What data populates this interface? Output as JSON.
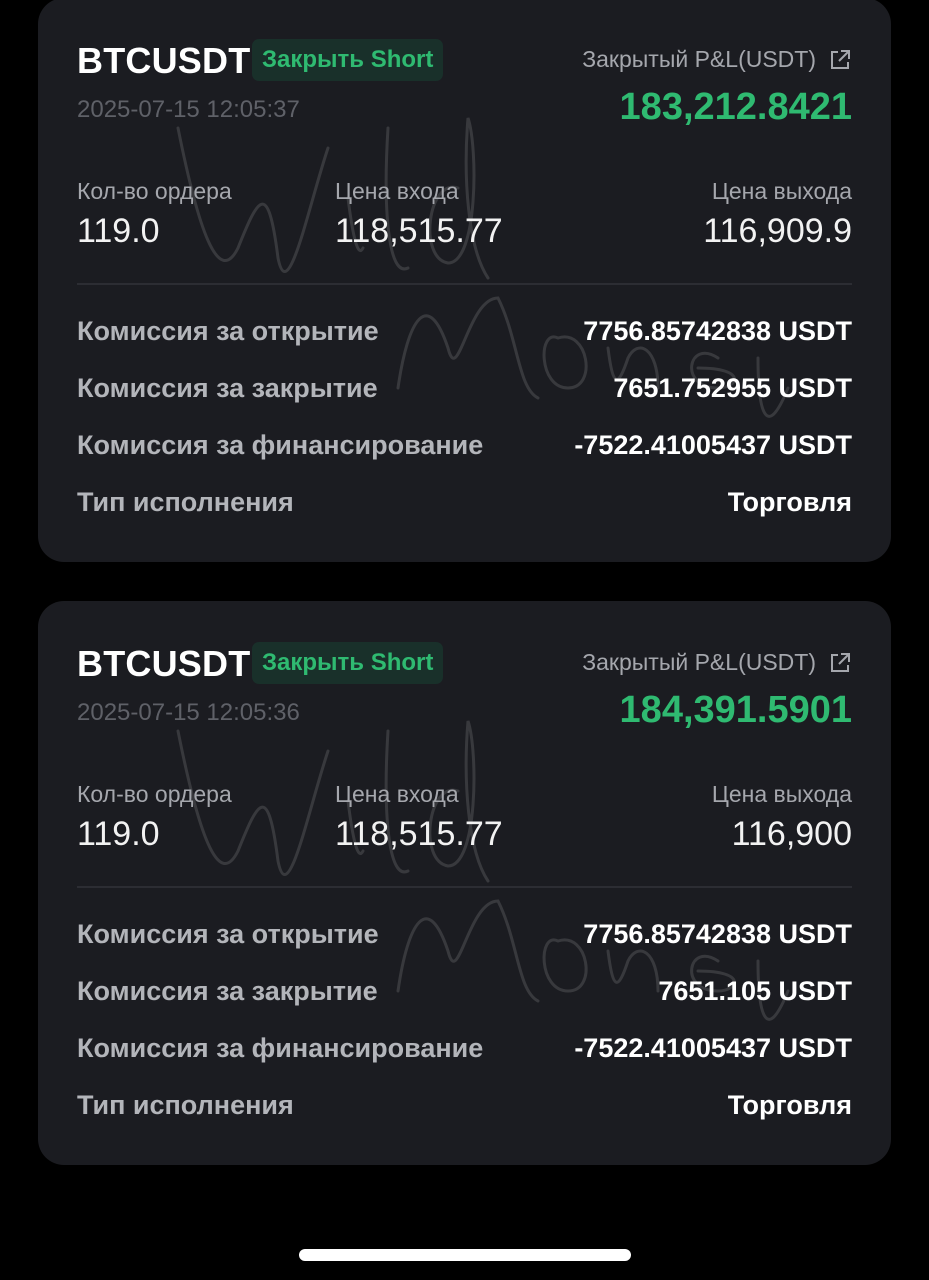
{
  "colors": {
    "background": "#000000",
    "card": "#1b1c21",
    "profit_green": "#2fba71",
    "badge_bg": "#19302a",
    "label_gray": "#a5a7ad",
    "muted_gray": "#5f6168"
  },
  "icons": {
    "external_link": "external-link-icon"
  },
  "watermark_text": "Wild Money Pro",
  "cards": [
    {
      "symbol": "BTCUSDT",
      "side_badge": "Закрыть Short",
      "timestamp": "2025-07-15 12:05:37",
      "pnl_label": "Закрытый P&L(USDT)",
      "pnl_value": "183,212.8421",
      "stats": [
        {
          "label": "Кол-во ордера",
          "value": "119.0"
        },
        {
          "label": "Цена входа",
          "value": "118,515.77"
        },
        {
          "label": "Цена выхода",
          "value": "116,909.9"
        }
      ],
      "rows": [
        {
          "label": "Комиссия за открытие",
          "value": "7756.85742838 USDT"
        },
        {
          "label": "Комиссия за закрытие",
          "value": "7651.752955 USDT"
        },
        {
          "label": "Комиссия за финансирование",
          "value": "-7522.41005437 USDT"
        },
        {
          "label": "Тип исполнения",
          "value": "Торговля"
        }
      ]
    },
    {
      "symbol": "BTCUSDT",
      "side_badge": "Закрыть Short",
      "timestamp": "2025-07-15 12:05:36",
      "pnl_label": "Закрытый P&L(USDT)",
      "pnl_value": "184,391.5901",
      "stats": [
        {
          "label": "Кол-во ордера",
          "value": "119.0"
        },
        {
          "label": "Цена входа",
          "value": "118,515.77"
        },
        {
          "label": "Цена выхода",
          "value": "116,900"
        }
      ],
      "rows": [
        {
          "label": "Комиссия за открытие",
          "value": "7756.85742838 USDT"
        },
        {
          "label": "Комиссия за закрытие",
          "value": "7651.105 USDT"
        },
        {
          "label": "Комиссия за финансирование",
          "value": "-7522.41005437 USDT"
        },
        {
          "label": "Тип исполнения",
          "value": "Торговля"
        }
      ]
    }
  ]
}
